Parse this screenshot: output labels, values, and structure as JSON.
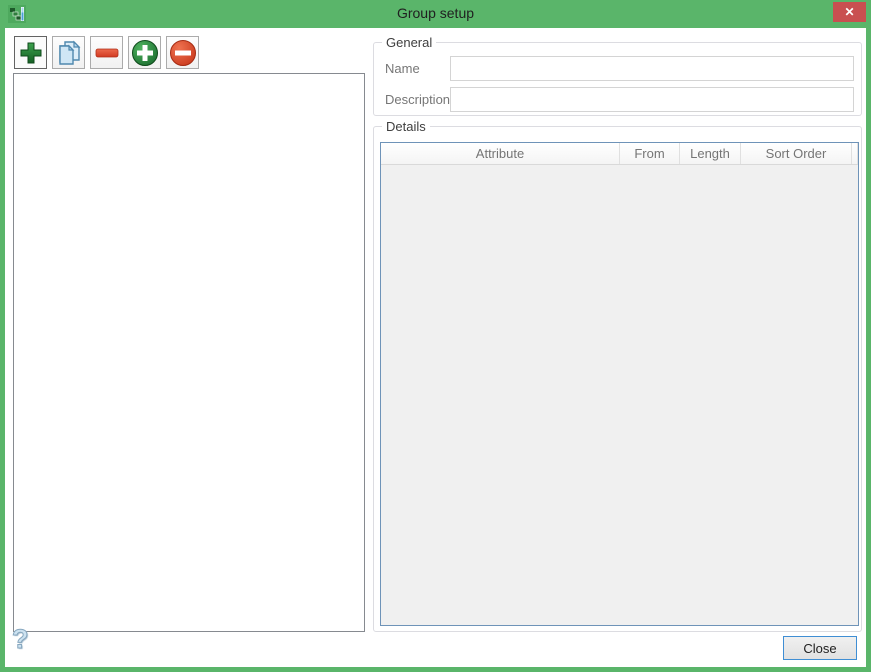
{
  "window": {
    "title": "Group setup",
    "close_glyph": "✕"
  },
  "toolbar": {
    "buttons": [
      {
        "icon": "green-plus",
        "action": "add"
      },
      {
        "icon": "copy-pages",
        "action": "copy"
      },
      {
        "icon": "red-minus-bar",
        "action": "remove"
      },
      {
        "icon": "green-plus-circle",
        "action": "add-detail"
      },
      {
        "icon": "red-minus-circle",
        "action": "remove-detail"
      }
    ]
  },
  "group_list": {
    "items": []
  },
  "general": {
    "legend": "General",
    "fields": [
      {
        "label": "Name",
        "value": ""
      },
      {
        "label": "Description",
        "value": ""
      }
    ]
  },
  "details": {
    "legend": "Details",
    "table": {
      "columns": [
        "Attribute",
        "From",
        "Length",
        "Sort Order"
      ],
      "rows": []
    }
  },
  "footer": {
    "close_label": "Close",
    "help_glyph": "?"
  },
  "colors": {
    "frame_green": "#5ab56a",
    "close_red": "#c94f50",
    "grid_border_blue": "#6e93b8",
    "default_button_border_blue": "#3f8ed4",
    "icon_green": "#1f7a2f",
    "icon_red": "#d9402a",
    "copy_blue": "#4f88ae"
  }
}
